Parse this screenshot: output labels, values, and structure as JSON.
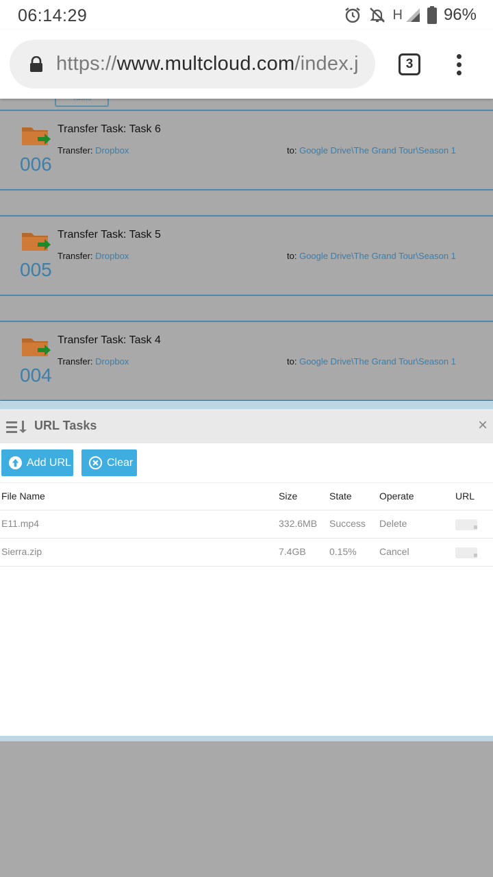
{
  "status_bar": {
    "time": "06:14:29",
    "network": "H",
    "battery": "96%",
    "icons": [
      "alarm-icon",
      "bell-off-icon",
      "signal-icon",
      "battery-icon"
    ]
  },
  "browser": {
    "url_scheme": "https://",
    "url_host": "www.multcloud.com",
    "url_path": "/index.j",
    "tab_count": "3"
  },
  "page": {
    "tasks_button_label": "Tasks",
    "tasks": [
      {
        "number": "006",
        "title": "Transfer Task: Task 6",
        "from_label": "Transfer: ",
        "from": "Dropbox",
        "to_label": "to: ",
        "to": "Google Drive\\The Grand Tour\\Season 1"
      },
      {
        "number": "005",
        "title": "Transfer Task: Task 5",
        "from_label": "Transfer: ",
        "from": "Dropbox",
        "to_label": "to: ",
        "to": "Google Drive\\The Grand Tour\\Season 1"
      },
      {
        "number": "004",
        "title": "Transfer Task: Task 4",
        "from_label": "Transfer: ",
        "from": "Dropbox",
        "to_label": "to: ",
        "to": "Google Drive\\The Grand Tour\\Season 1"
      }
    ]
  },
  "panel": {
    "title": "URL Tasks",
    "close_label": "×",
    "add_url_label": "Add URL",
    "clear_label": "Clear",
    "columns": [
      "File Name",
      "Size",
      "State",
      "Operate",
      "URL"
    ],
    "rows": [
      {
        "file": "E11.mp4",
        "size": "332.6MB",
        "state": "Success",
        "operate": "Delete"
      },
      {
        "file": "Sierra.zip",
        "size": "7.4GB",
        "state": "0.15%",
        "operate": "Cancel"
      }
    ]
  },
  "colors": {
    "accent": "#3eaee0",
    "link": "#3a7eab",
    "overlay_gray": "#a9a9a9",
    "panel_border": "#bcd6e4"
  }
}
